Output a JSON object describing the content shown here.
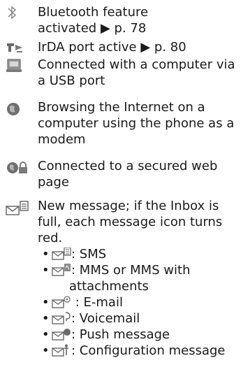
{
  "items": [
    {
      "icon": "bluetooth-icon",
      "lines": [
        "Bluetooth feature",
        "activated ▶ p. 78"
      ]
    },
    {
      "icon": "irda-icon",
      "lines": [
        "IrDA port active ▶ p. 80"
      ]
    },
    {
      "icon": "usb-computer-icon",
      "lines": [
        "Connected with a computer via",
        "a USB port"
      ]
    },
    {
      "icon": "globe-icon",
      "lines": [
        "Browsing the Internet on a",
        "computer using the phone as a",
        "modem"
      ]
    },
    {
      "icon": "secure-globe-lock-icon",
      "lines": [
        "Connected to a secured web",
        "page"
      ]
    },
    {
      "icon": "new-message-icon",
      "lines": [
        "New message; if the Inbox is",
        "full, each message icon turns",
        "red."
      ]
    }
  ],
  "message_types": [
    {
      "icon": "sms-icon",
      "text": ": SMS"
    },
    {
      "icon": "mms-icon",
      "text": ": MMS or MMS with",
      "cont": "attachments"
    },
    {
      "icon": "email-icon",
      "text": " : E-mail"
    },
    {
      "icon": "voicemail-icon",
      "text": ": Voicemail"
    },
    {
      "icon": "push-message-icon",
      "text": ": Push message"
    },
    {
      "icon": "configuration-message-icon",
      "text": ": Configuration message"
    }
  ],
  "bullet": "•",
  "icon_color": "#7a7a7a"
}
